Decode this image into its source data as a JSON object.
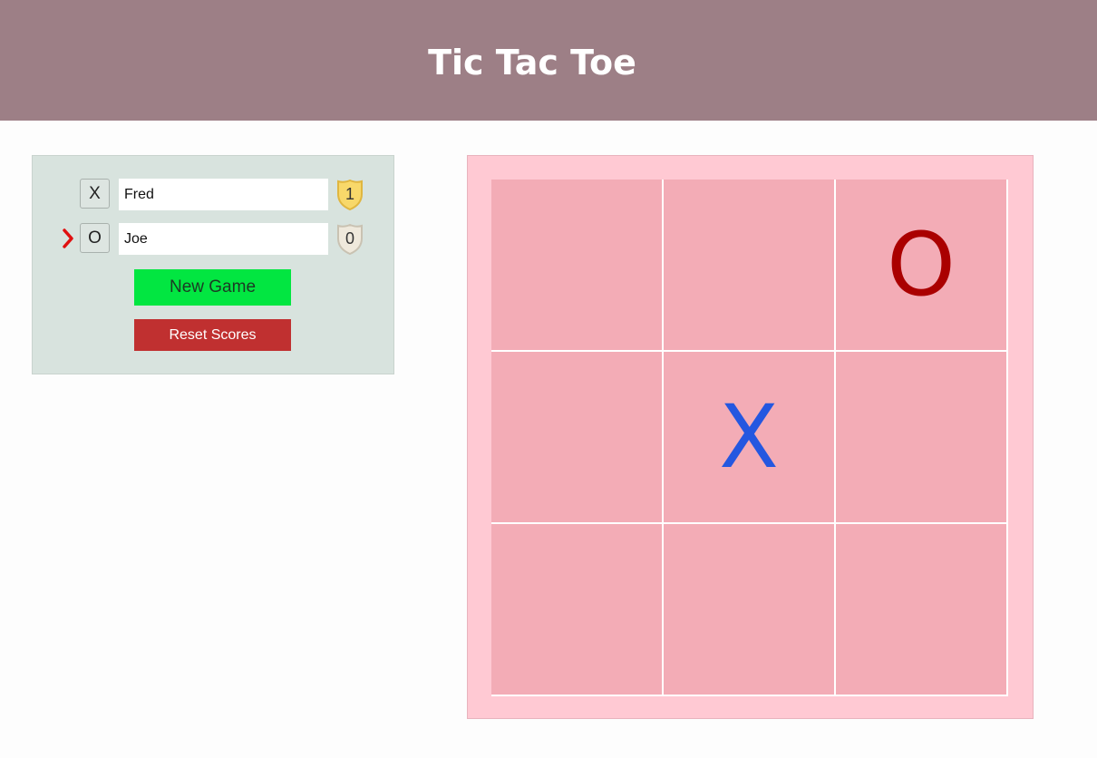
{
  "header": {
    "title": "Tic Tac Toe"
  },
  "players": [
    {
      "mark": "X",
      "name": "Fred",
      "score": "1",
      "badge_color": "#f8d86a",
      "is_turn": false
    },
    {
      "mark": "O",
      "name": "Joe",
      "score": "0",
      "badge_color": "#efe9dc",
      "is_turn": true
    }
  ],
  "controls": {
    "new_game_label": "New Game",
    "reset_scores_label": "Reset Scores"
  },
  "board": {
    "cells": [
      "",
      "",
      "O",
      "",
      "X",
      "",
      "",
      "",
      ""
    ]
  },
  "colors": {
    "header_bg": "#9d7f86",
    "x_color": "#2457e0",
    "o_color": "#aa0000",
    "turn_arrow": "#e01010"
  }
}
